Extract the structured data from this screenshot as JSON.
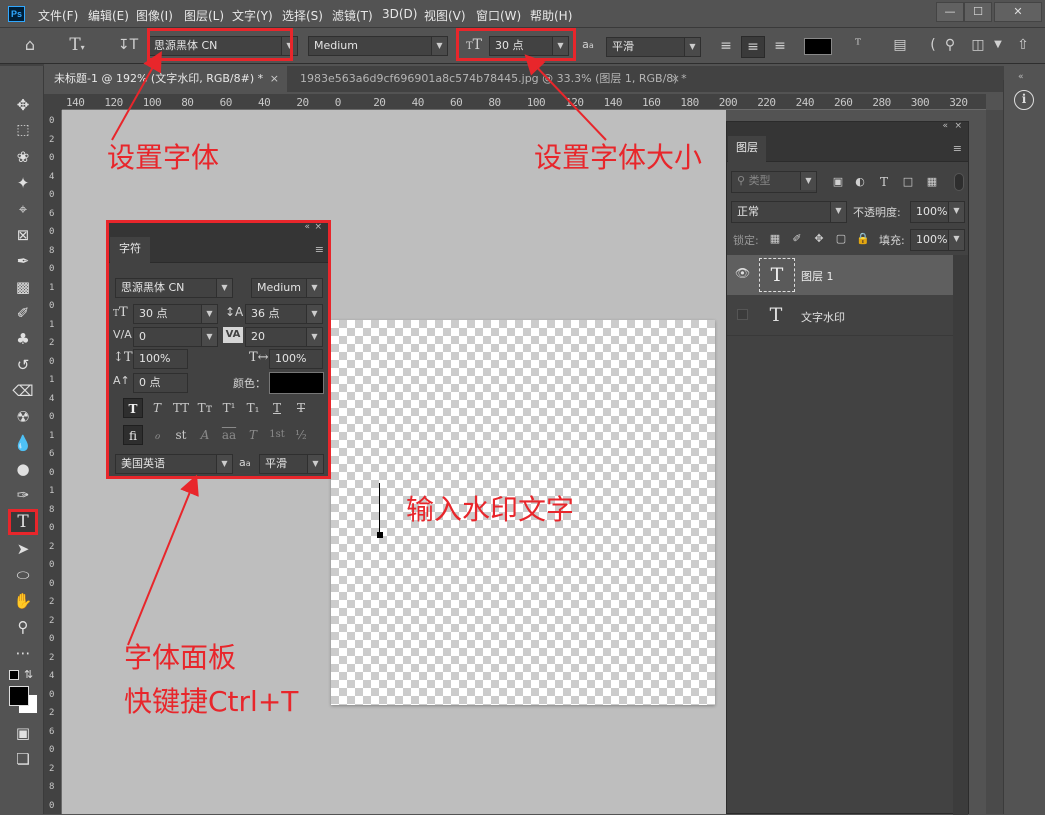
{
  "menubar": {
    "items": [
      "文件(F)",
      "编辑(E)",
      "图像(I)",
      "图层(L)",
      "文字(Y)",
      "选择(S)",
      "滤镜(T)",
      "3D(D)",
      "视图(V)",
      "窗口(W)",
      "帮助(H)"
    ],
    "logo": "Ps"
  },
  "optionsbar": {
    "font_family": "思源黑体 CN",
    "font_style": "Medium",
    "font_size": "30 点",
    "antialias": "平滑"
  },
  "tabs": [
    {
      "label": "未标题-1 @ 192% (文字水印, RGB/8#) *",
      "active": true
    },
    {
      "label": "1983e563a6d9cf696901a8c574b78445.jpg @ 33.3% (图层 1, RGB/8) *",
      "active": false
    }
  ],
  "ruler": {
    "h_ticks": [
      "140",
      "120",
      "100",
      "80",
      "60",
      "40",
      "20",
      "0",
      "20",
      "40",
      "60",
      "80",
      "100",
      "120",
      "140",
      "160",
      "180",
      "200",
      "220",
      "240",
      "260",
      "280",
      "300",
      "320"
    ],
    "v_ticks": [
      "0",
      "2",
      "0",
      "4",
      "0",
      "6",
      "0",
      "8",
      "0",
      "1",
      "0",
      "1",
      "2",
      "0",
      "1",
      "4",
      "0",
      "1",
      "6",
      "0",
      "1",
      "8",
      "0",
      "2",
      "0",
      "0",
      "2",
      "2",
      "0",
      "2",
      "4",
      "0",
      "2",
      "6",
      "0",
      "2",
      "8",
      "0"
    ]
  },
  "character_panel": {
    "title": "字符",
    "font_family": "思源黑体 CN",
    "font_style": "Medium",
    "font_size": "30 点",
    "leading": "36 点",
    "kerning": "0",
    "tracking": "20",
    "vertical_scale": "100%",
    "horizontal_scale": "100%",
    "baseline_shift": "0 点",
    "color_label": "颜色：",
    "language": "美国英语",
    "antialias": "平滑",
    "style_buttons": [
      "T",
      "T",
      "TT",
      "Tт",
      "T¹",
      "T₁",
      "T",
      "T"
    ],
    "opentype_buttons": [
      "fi",
      "ℴ",
      "st",
      "A",
      "aa",
      "T",
      "1st",
      "½"
    ]
  },
  "layers_panel": {
    "title": "图层",
    "filter_label": "类型",
    "blend_mode": "正常",
    "opacity_label": "不透明度:",
    "opacity": "100%",
    "lock_label": "锁定:",
    "fill_label": "填充:",
    "fill": "100%",
    "layers": [
      {
        "name": "图层 1",
        "visible": true,
        "selected": true
      },
      {
        "name": "文字水印",
        "visible": false,
        "selected": false
      }
    ]
  },
  "annotations": {
    "set_font": "设置字体",
    "set_font_size": "设置字体大小",
    "enter_text": "输入水印文字",
    "char_panel_1": "字体面板",
    "char_panel_2": "快键捷Ctrl+T"
  },
  "colors": {
    "annotation": "#e8262b",
    "ui_bg": "#535353",
    "panel_bg": "#424242",
    "canvas_bg": "#bebebe",
    "foreground": "#000000",
    "background": "#ffffff"
  }
}
